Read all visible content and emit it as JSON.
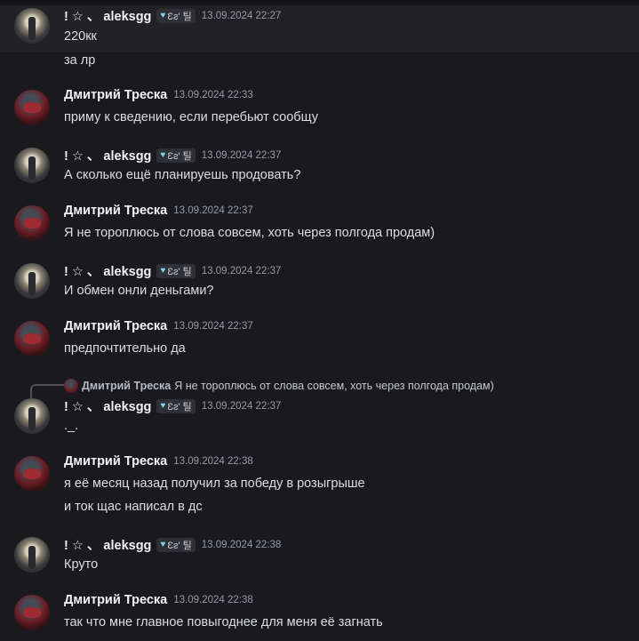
{
  "users": {
    "aleks": {
      "name": "! ☆ 、 aleksgg",
      "badge_heart": "♥",
      "badge_text": "Ɛƨ' 틸"
    },
    "dmitriy": {
      "name": "Дмитрий Треска"
    }
  },
  "messages": [
    {
      "author": "aleks",
      "timestamp": "13.09.2024 22:27",
      "lines": [
        "220кк",
        "за лр"
      ]
    },
    {
      "author": "dmitriy",
      "timestamp": "13.09.2024 22:33",
      "lines": [
        "приму к сведению, если перебьют сообщу"
      ]
    },
    {
      "author": "aleks",
      "timestamp": "13.09.2024 22:37",
      "lines": [
        "А сколько ещё планируешь продовать?"
      ]
    },
    {
      "author": "dmitriy",
      "timestamp": "13.09.2024 22:37",
      "lines": [
        "Я не тороплюсь от слова совсем, хоть через полгода продам)"
      ]
    },
    {
      "author": "aleks",
      "timestamp": "13.09.2024 22:37",
      "lines": [
        "И обмен онли деньгами?"
      ]
    },
    {
      "author": "dmitriy",
      "timestamp": "13.09.2024 22:37",
      "lines": [
        "предпочтительно да"
      ]
    },
    {
      "author": "aleks",
      "timestamp": "13.09.2024 22:37",
      "lines": [
        "._."
      ],
      "reply": {
        "name": "Дмитрий Треска",
        "text": "Я не тороплюсь от слова совсем, хоть через полгода продам)"
      }
    },
    {
      "author": "dmitriy",
      "timestamp": "13.09.2024 22:38",
      "lines": [
        "я её месяц назад получил за победу в розыгрыше",
        "и ток щас написал в дс"
      ]
    },
    {
      "author": "aleks",
      "timestamp": "13.09.2024 22:38",
      "lines": [
        "Круто"
      ]
    },
    {
      "author": "dmitriy",
      "timestamp": "13.09.2024 22:38",
      "lines": [
        "так что мне главное повыгоднее для меня её загнать"
      ]
    }
  ]
}
